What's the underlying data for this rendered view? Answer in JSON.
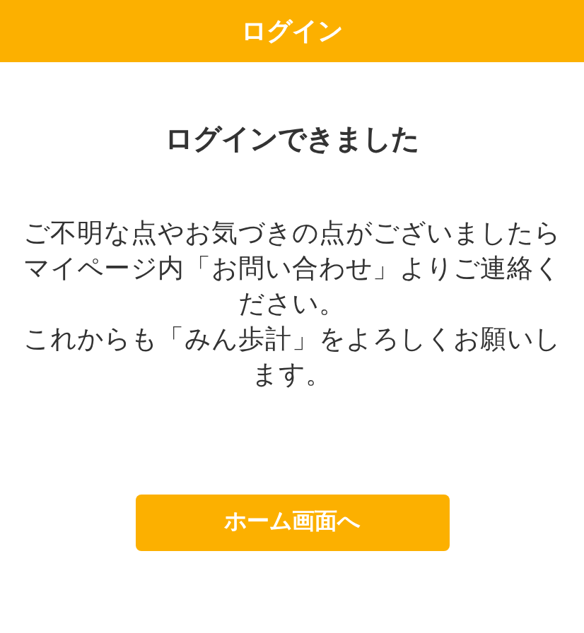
{
  "header": {
    "title": "ログイン"
  },
  "heading": "ログインできました",
  "paragraphs": [
    "ご不明な点やお気づきの点がございましたらマイページ内「お問い合わせ」よりご連絡ください。",
    "これからも「みん歩計」をよろしくお願いします。"
  ],
  "button": {
    "label": "ホーム画面へ"
  }
}
